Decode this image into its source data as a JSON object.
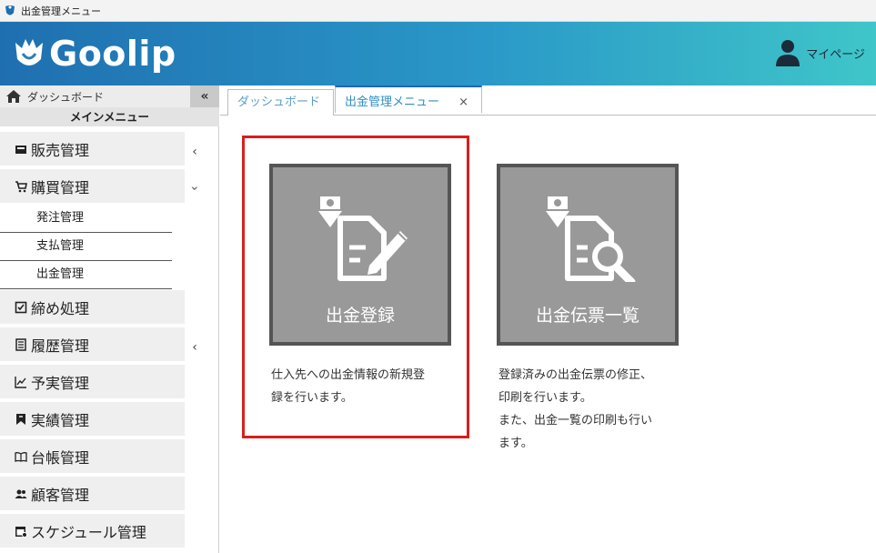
{
  "window": {
    "title": "出金管理メニュー"
  },
  "header": {
    "logo_text": "Goolip",
    "mypage_label": "マイページ"
  },
  "sidebar": {
    "dashboard_label": "ダッシュボード",
    "collapse_glyph": "«",
    "menu_heading": "メインメニュー",
    "items": [
      {
        "label": "販売管理",
        "icon": "register-icon"
      },
      {
        "label": "購買管理",
        "icon": "cart-icon"
      },
      {
        "label": "締め処理",
        "icon": "checkbox-icon"
      },
      {
        "label": "履歴管理",
        "icon": "document-list-icon"
      },
      {
        "label": "予実管理",
        "icon": "chart-line-icon"
      },
      {
        "label": "実績管理",
        "icon": "bookmark-icon"
      },
      {
        "label": "台帳管理",
        "icon": "book-open-icon"
      },
      {
        "label": "顧客管理",
        "icon": "users-icon"
      },
      {
        "label": "スケジュール管理",
        "icon": "calendar-icon"
      }
    ],
    "sub_items": [
      "発注管理",
      "支払管理",
      "出金管理"
    ]
  },
  "tabs": [
    {
      "label": "ダッシュボード"
    },
    {
      "label": "出金管理メニュー",
      "close": "×"
    }
  ],
  "cards": [
    {
      "label": "出金登録",
      "icon": "document-edit-icon",
      "desc_lines": [
        "仕入先への出金情報の新規登",
        "録を行います。"
      ]
    },
    {
      "label": "出金伝票一覧",
      "icon": "document-search-icon",
      "desc_lines": [
        "登録済みの出金伝票の修正、",
        "印刷を行います。",
        "また、出金一覧の印刷も行い",
        "ます。"
      ]
    }
  ],
  "colors": {
    "header_start": "#1f6fb0",
    "header_end": "#3fc6c9",
    "card_bg": "#999999",
    "highlight": "#d81e1e",
    "active_tab": "#1e63c8"
  }
}
